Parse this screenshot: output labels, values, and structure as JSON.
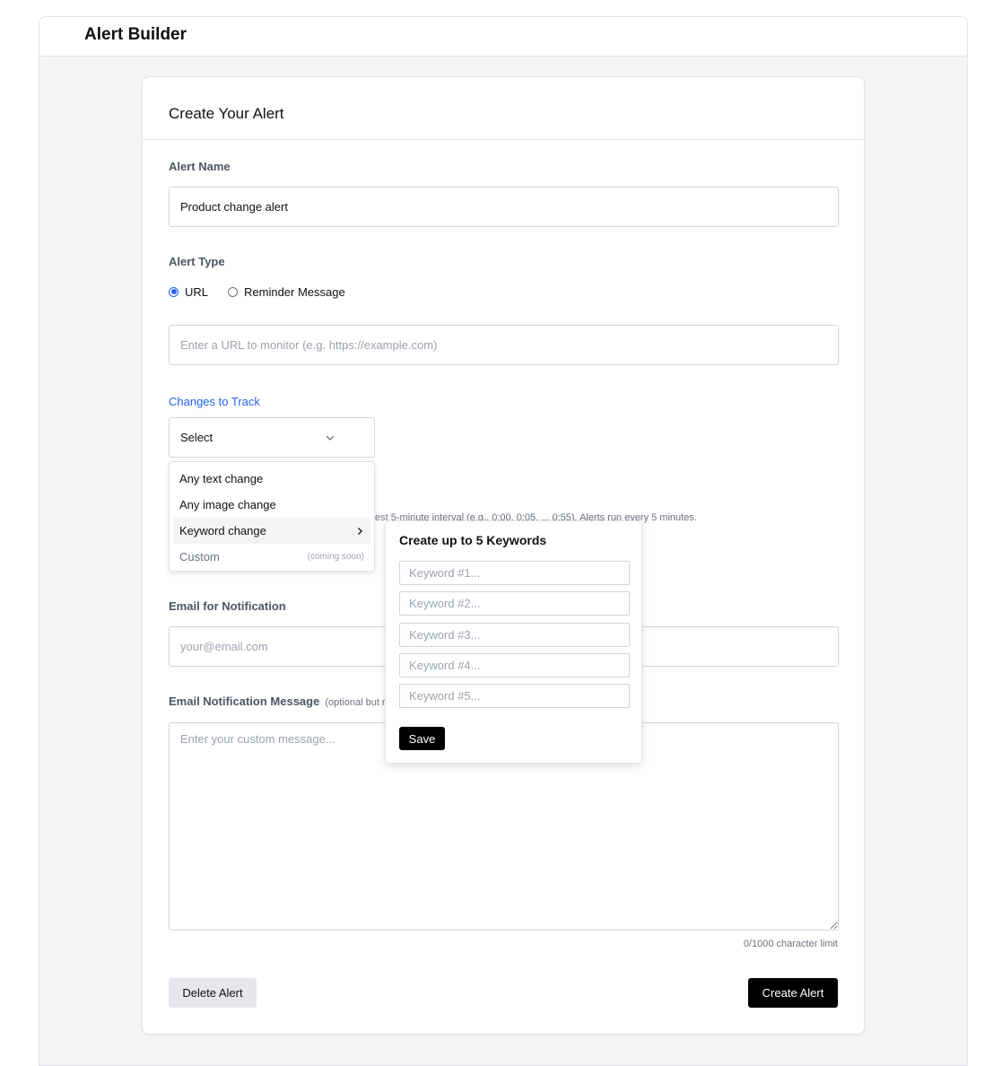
{
  "app": {
    "title": "Alert Builder"
  },
  "card": {
    "title": "Create Your Alert"
  },
  "alert_name": {
    "label": "Alert Name",
    "value": "Product change alert"
  },
  "alert_type": {
    "label": "Alert Type",
    "options": [
      "URL",
      "Reminder Message"
    ],
    "selected": "URL"
  },
  "url_input": {
    "placeholder": "Enter a URL to monitor (e.g. https://example.com)"
  },
  "changes": {
    "label": "Changes to Track",
    "select_value": "Select",
    "menu": [
      {
        "label": "Any text change"
      },
      {
        "label": "Any image change"
      },
      {
        "label": "Keyword change"
      },
      {
        "label": "Custom",
        "note": "(coming soon)"
      }
    ]
  },
  "hint_text": "est 5-minute interval (e.g., 0:00, 0:05, ... 0:55). Alerts run every 5 minutes.",
  "keywords_popover": {
    "title": "Create up to 5 Keywords",
    "placeholders": [
      "Keyword #1...",
      "Keyword #2...",
      "Keyword #3...",
      "Keyword #4...",
      "Keyword #5..."
    ],
    "save_label": "Save"
  },
  "email": {
    "label": "Email for Notification",
    "placeholder": "your@email.com"
  },
  "message": {
    "label": "Email Notification Message",
    "optional_note": "(optional but r",
    "placeholder": "Enter your custom message...",
    "char_limit": "0/1000 character limit"
  },
  "actions": {
    "delete_label": "Delete Alert",
    "create_label": "Create Alert"
  },
  "colors": {
    "accent": "#2563eb",
    "primary_button": "#000000",
    "secondary_button": "#e5e7eb"
  },
  "icons": {
    "select_chevron": "chevron-down-icon",
    "submenu_arrow": "chevron-right-icon"
  }
}
